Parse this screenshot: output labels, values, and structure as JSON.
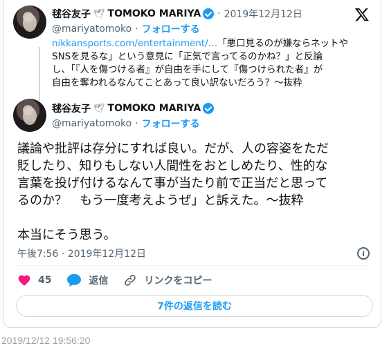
{
  "parent_tweet": {
    "author_name": "毬谷友子",
    "author_emoji": "🕊",
    "author_name_en": "TOMOKO MARIYA",
    "date": "2019年12月12日",
    "handle": "@mariyatomoko",
    "follow_label": "フォローする",
    "link_text": "nikkansports.com/entertainment/…",
    "text_line1_rest": "「悪口見るのが嫌ならネットや",
    "text_line2": "SNSを見るな」という意見に「正気で言ってるのかね？」と反論",
    "text_line3": "し、「『人を傷つける者』が自由を手にして『傷つけられた者』が",
    "text_line4": "自由を奪われるなんてことあって良い訳ないだろう？～抜粋"
  },
  "main_tweet": {
    "author_name": "毬谷友子",
    "author_emoji": "🕊",
    "author_name_en": "TOMOKO MARIYA",
    "handle": "@mariyatomoko",
    "follow_label": "フォローする",
    "text_line1": "議論や批評は存分にすれば良い。だが、人の容姿をただ",
    "text_line2": "貶したり、知りもしない人間性をおとしめたり、性的な",
    "text_line3": "言葉を投げ付けるなんて事が当たり前で正当だと思って",
    "text_line4": "るのか？　もう一度考えようぜ」と訴えた。～抜粋",
    "text_line5": "",
    "text_line6": "本当にそう思う。",
    "timestamp": "午後7:56 · 2019年12月12日"
  },
  "actions": {
    "like_count": "45",
    "reply_label": "返信",
    "copy_link_label": "リンクをコピー"
  },
  "read_replies_label": "7件の返信を読む",
  "capture_timestamp": "2019/12/12 19:56:20",
  "icons": {
    "logo": "x-logo-icon",
    "verified": "verified-badge-icon",
    "info": "info-icon",
    "like": "heart-icon",
    "reply": "speech-bubble-icon",
    "link": "link-icon"
  },
  "colors": {
    "accent": "#1d9bf0",
    "like": "#f91880",
    "text": "#0f1419",
    "secondary": "#536471"
  }
}
